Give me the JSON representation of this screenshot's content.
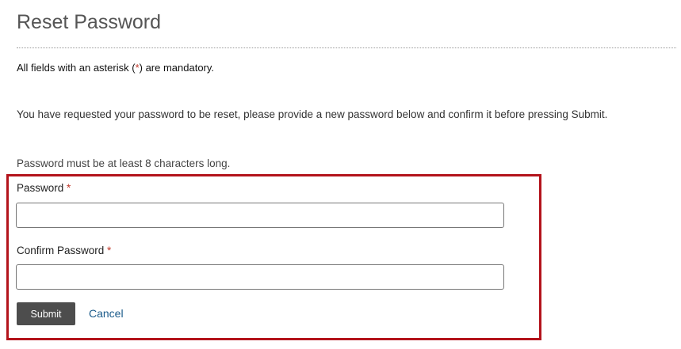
{
  "page": {
    "title": "Reset Password"
  },
  "notes": {
    "mandatory_prefix": "All fields with an asterisk (",
    "mandatory_star": "*",
    "mandatory_suffix": ") are mandatory.",
    "intro": "You have requested your password to be reset, please provide a new password below and confirm it before pressing Submit.",
    "length_rule": "Password must be at least 8 characters long."
  },
  "form": {
    "password_label": "Password",
    "password_star": "*",
    "password_value": "",
    "confirm_label": "Confirm Password",
    "confirm_star": "*",
    "confirm_value": "",
    "submit_label": "Submit",
    "cancel_label": "Cancel"
  },
  "colors": {
    "highlight_border": "#b3131b",
    "required_star": "#c0392b",
    "submit_bg": "#4d4d4d",
    "link": "#1a5a8a"
  }
}
